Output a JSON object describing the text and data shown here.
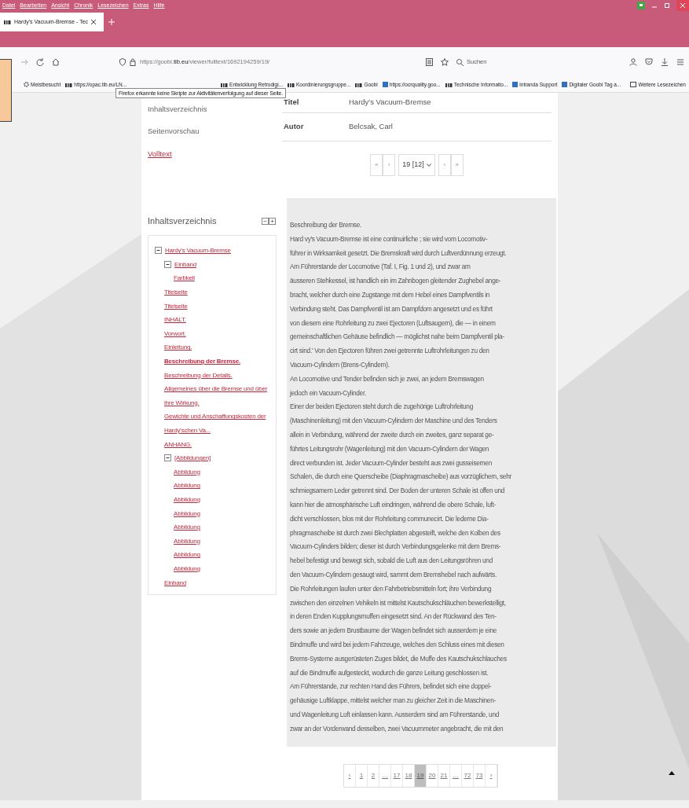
{
  "menu_bar": [
    "Datei",
    "Bearbeiten",
    "Ansicht",
    "Chronik",
    "Lesezeichen",
    "Extras",
    "Hilfe"
  ],
  "tab": {
    "title": "Hardy's Vacuum-Bremse - Tec",
    "selected": true
  },
  "address_bar": {
    "url_prefix": "https://goobi.",
    "url_domain": "tib.eu",
    "url_path": "/viewer/fulltext/1692194259/19/"
  },
  "search": {
    "placeholder": "Suchen"
  },
  "bookmarks": [
    {
      "label": "Meistbesucht",
      "kind": "gear"
    },
    {
      "label": "https://opac.tib.eu/LN...",
      "kind": "tib"
    },
    {
      "label": "Entwicklung Retrodigi...",
      "kind": "tib"
    },
    {
      "label": "Koordinierungsgruppe...",
      "kind": "tib"
    },
    {
      "label": "Goobi",
      "kind": "tib"
    },
    {
      "label": "https://ocrquality.goo...",
      "kind": "blue"
    },
    {
      "label": "Technische Informatio...",
      "kind": "tib"
    },
    {
      "label": "intranda Support",
      "kind": "blue"
    },
    {
      "label": "Digitaler Goobi Tag a...",
      "kind": "blue"
    }
  ],
  "more_bookmarks": "Weitere Lesezeichen",
  "tooltip": "Firefox erkannte keine Skripte zur Aktivitätenverfolgung auf dieser Seite.",
  "view_nav": [
    {
      "label": "Inhaltsverzeichnis",
      "selected": false
    },
    {
      "label": "Seitenvorschau",
      "selected": false
    },
    {
      "label": "Volltext",
      "selected": true
    }
  ],
  "metadata": [
    {
      "label": "Titel",
      "value": "Hardy's Vacuum-Bremse"
    },
    {
      "label": "Autor",
      "value": "Belcsak, Carl"
    }
  ],
  "page_select": {
    "first": "«",
    "prev": "‹",
    "value": "19 [12]",
    "next": "›",
    "last": "»"
  },
  "toc": {
    "title": "Inhaltsverzeichnis",
    "collapse_all": "−",
    "expand_all": "+",
    "items": [
      {
        "label": "Hardy's Vacuum-Bremse",
        "selected": false,
        "expanded": true,
        "children": [
          {
            "label": "Einband",
            "selected": false,
            "expanded": true,
            "children": [
              {
                "label": "Farbkeil",
                "selected": false
              }
            ]
          },
          {
            "label": "Titelseite",
            "selected": false
          },
          {
            "label": "Titelseite",
            "selected": false
          },
          {
            "label": "INHALT.",
            "selected": false
          },
          {
            "label": "Vorwort.",
            "selected": false
          },
          {
            "label": "Einleitung.",
            "selected": false
          },
          {
            "label": "Beschreibung der Bremse.",
            "selected": true
          },
          {
            "label": "Beschreibung der Details.",
            "selected": false
          },
          {
            "label": "Allgemeines über die Bremse und über ihre Wirkung.",
            "selected": false
          },
          {
            "label": "Gewichte und Anschaffungskosten der Hardy'schen Va...",
            "selected": false
          },
          {
            "label": "ANHANG.",
            "selected": false
          },
          {
            "label": "[Abbildungen]",
            "selected": false,
            "expanded": true,
            "children": [
              {
                "label": "Abbildung",
                "selected": false
              },
              {
                "label": "Abbildung",
                "selected": false
              },
              {
                "label": "Abbildung",
                "selected": false
              },
              {
                "label": "Abbildung",
                "selected": false
              },
              {
                "label": "Abbildung",
                "selected": false
              },
              {
                "label": "Abbildung",
                "selected": false
              },
              {
                "label": "Abbildung",
                "selected": false
              },
              {
                "label": "Abbildung",
                "selected": false
              }
            ]
          },
          {
            "label": "Einband",
            "selected": false
          }
        ]
      }
    ]
  },
  "fulltext": [
    "Beschreibung der Bremse.",
    "Hard vy's Vacuum-Bremse ist eine continuirliche ; sie wird vom Locomotiv-",
    "führer in Wirksamkeit gesetzt. Die Bremskraft wird durch Luftverdünnung erzeugt.",
    "Am Führerstande der Locomotive (Taf. I, Fig. 1 und 2), und zwar am",
    "äusseren Stehkessel, ist handlich ein im Zahnbogen gleitender Zughebel ange-",
    "bracht, welcher durch eine Zugstange mit dem Hebel eines Dampfventils in",
    "Verbindung steht. Das Dampfventil ist am Dampfdom angesetzt und es führt",
    "von diesem eine Rohrleitung zu zwei Ejectoren (Luftsaugern), die — in einem",
    "gemeinschaftlichen Gehäuse befindlich — möglichst nahe beim Dampfventil pla-",
    "cirt sind.' Von den Ejectoren führen zwei getrennte Luftrohrleitungen zu den",
    "Vacuum-Cylindern (Brens-Cylindern).",
    "An Locomotive und Tender befinden sich je zwei, an jedem Bremswagen",
    "jedoch ein Vacuum-Cylinder.",
    "Einer der beiden Ejectoren steht durch die zugehörige Luftrohrleitung",
    "(Maschinenleitung) mit den Vacuum-Cylindern der Maschine und des Tenders",
    "allein in Verbindung, während der zweite durch ein zweites, ganz separat ge-",
    "führtes Leitungsrohr (Wagenleitung) mit den Vacuum-Cylindern der Wagen",
    "direct verbunden ist. Jeder Vacuum-Cylinder besteht aus zwei gusseisernen",
    "Schalen, die durch eine Querscheibe (Diaphragmascheibe) aus vorzüglichem, sehr",
    "schmiegsamem Leder getrennt sind. Der Boden der unteren Schale ist offen und",
    "kann hier die atmosphärische Luft eindringen, während die obere Schale, luft-",
    "dicht verschlossen, blos mit der Rohrleitung communecirt. Die lederne Dia-",
    "phragmascheibe ist durch zwei Blechplatten abgesteift, welche den Kolben des",
    "Vacuum-Cylinders bilden; dieser ist durch Verbindungsgelenke mit dem Brems-",
    "hebel befestigt und bewegt sich, sobald die Luft aus den Leitungsröhren und",
    "den Vacuum-Cylindern gesaugt wird, sammt dem Bremshebel nach aufwärts.",
    "Die Rohrleitungen laufen unter den Fahrbetriebsmitteln fort; ihre Verbindung",
    "zwischen den einzelnen Vehikeln ist mittelst Kautschukschläuchen bewerkstelligt,",
    "in deren Enden Kupplungsmuffen eingesetzt sind. An der Rückwand des Ten-",
    "ders sowie an jedem Brustbaume der Wagen befindet sich ausserdem je eine",
    "Bindmuffe und wird bei jedem Fahrzeuge, welches den Schluss eines mit diesen",
    "Brems-Systeme ausgerüsteten Zuges bildet, die Muffe des Kautschukschlauches",
    "auf die Bindmuffe aufgesteckt, wodurch die ganze Leitung geschlossen ist.",
    "Am Führerstande, zur rechten Hand des Führers, befindet sich eine doppel-",
    "gehäusige Luftklappe, mittelst welcher man zu gleicher Zeit in die Maschinen-",
    "und Wagenleitung Luft einlassen kann. Ausserdem sind am Führerstande, und",
    "zwar an der Vorderwand desselben, zwei Vacuummeter angebracht, die mit den"
  ],
  "pagination": [
    {
      "label": "‹",
      "selected": false
    },
    {
      "label": "1",
      "selected": false
    },
    {
      "label": "2",
      "selected": false
    },
    {
      "label": "…",
      "selected": false
    },
    {
      "label": "17",
      "selected": false
    },
    {
      "label": "18",
      "selected": false
    },
    {
      "label": "19",
      "selected": true
    },
    {
      "label": "20",
      "selected": false
    },
    {
      "label": "21",
      "selected": false
    },
    {
      "label": "…",
      "selected": false
    },
    {
      "label": "72",
      "selected": false
    },
    {
      "label": "73",
      "selected": false
    },
    {
      "label": "›",
      "selected": false
    }
  ]
}
